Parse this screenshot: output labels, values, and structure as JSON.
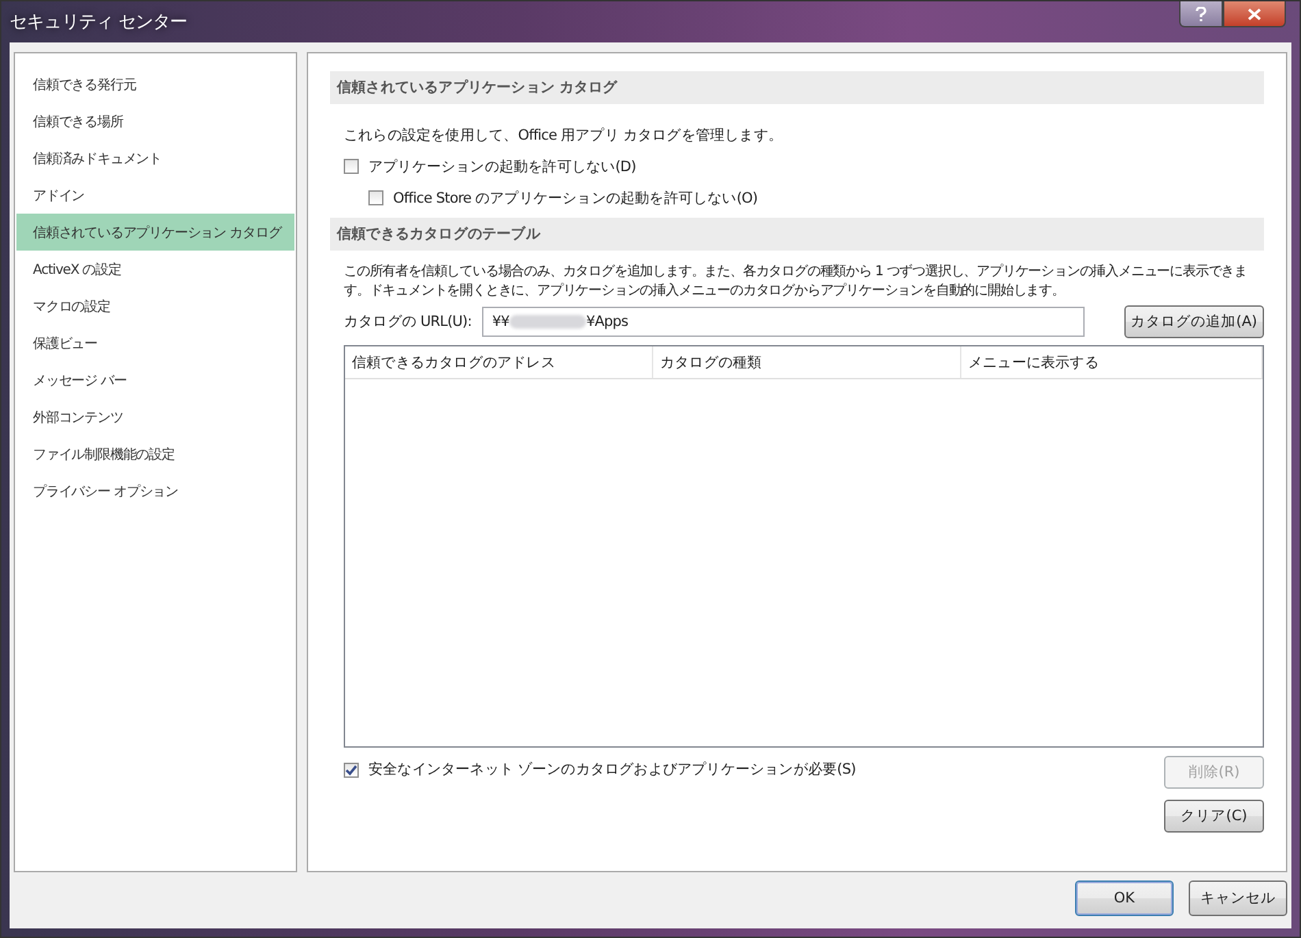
{
  "window": {
    "title": "セキュリティ センター"
  },
  "sidebar": {
    "items": [
      {
        "label": "信頼できる発行元",
        "selected": false
      },
      {
        "label": "信頼できる場所",
        "selected": false
      },
      {
        "label": "信頼済みドキュメント",
        "selected": false
      },
      {
        "label": "アドイン",
        "selected": false
      },
      {
        "label": "信頼されているアプリケーション カタログ",
        "selected": true
      },
      {
        "label": "ActiveX の設定",
        "selected": false
      },
      {
        "label": "マクロの設定",
        "selected": false
      },
      {
        "label": "保護ビュー",
        "selected": false
      },
      {
        "label": "メッセージ バー",
        "selected": false
      },
      {
        "label": "外部コンテンツ",
        "selected": false
      },
      {
        "label": "ファイル制限機能の設定",
        "selected": false
      },
      {
        "label": "プライバシー オプション",
        "selected": false
      }
    ]
  },
  "catalog_section": {
    "heading": "信頼されているアプリケーション カタログ",
    "description": "これらの設定を使用して、Office 用アプリ カタログを管理します。",
    "options": [
      {
        "label": "アプリケーションの起動を許可しない(D)",
        "checked": false,
        "children": [
          {
            "label": "Office Store のアプリケーションの起動を許可しない(O)",
            "checked": false
          }
        ]
      }
    ]
  },
  "table_section": {
    "heading": "信頼できるカタログのテーブル",
    "description": "この所有者を信頼している場合のみ、カタログを追加します。また、各カタログの種類から 1 つずつ選択し、アプリケーションの挿入メニューに表示できます。ドキュメントを開くときに、アプリケーションの挿入メニューのカタログからアプリケーションを自動的に開始します。",
    "url_label": "カタログの URL(U):",
    "url_value_start": "¥¥",
    "url_value_end": "¥Apps",
    "add_button": "カタログの追加(A)",
    "columns": [
      "信頼できるカタログのアドレス",
      "カタログの種類",
      "メニューに表示する"
    ],
    "secure_option": {
      "label": "安全なインターネット ゾーンのカタログおよびアプリケーションが必要(S)",
      "checked": true
    },
    "buttons": [
      {
        "label": "削除(R)",
        "disabled": true
      },
      {
        "label": "クリア(C)",
        "disabled": false
      }
    ]
  },
  "footer": {
    "buttons": [
      {
        "label": "OK",
        "default": true
      },
      {
        "label": "キャンセル",
        "default": false
      }
    ]
  }
}
